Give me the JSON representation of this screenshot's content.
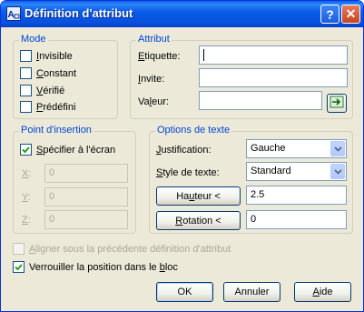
{
  "window": {
    "title": "Définition d'attribut",
    "help_button": "?",
    "close_button": "✕"
  },
  "mode": {
    "legend": "Mode",
    "options": [
      {
        "pre": "",
        "key": "I",
        "post": "nvisible",
        "checked": false
      },
      {
        "pre": "",
        "key": "C",
        "post": "onstant",
        "checked": false
      },
      {
        "pre": "",
        "key": "V",
        "post": "érifié",
        "checked": false
      },
      {
        "pre": "",
        "key": "P",
        "post": "rédéfini",
        "checked": false
      }
    ]
  },
  "attribut": {
    "legend": "Attribut",
    "etiquette": {
      "pre": "",
      "key": "E",
      "post": "tiquette:",
      "value": ""
    },
    "invite": {
      "pre": "",
      "key": "I",
      "post": "nvite:",
      "value": ""
    },
    "valeur": {
      "pre": "Va",
      "key": "l",
      "post": "eur:",
      "value": ""
    }
  },
  "insertion": {
    "legend": "Point d'insertion",
    "specify": {
      "pre": "",
      "key": "S",
      "post": "pécifier à l'écran",
      "checked": true
    },
    "x": {
      "label": "X",
      "suffix": ":",
      "value": "0"
    },
    "y": {
      "label": "Y",
      "suffix": ":",
      "value": "0"
    },
    "z": {
      "label": "Z",
      "suffix": ":",
      "value": "0"
    }
  },
  "texte": {
    "legend": "Options de texte",
    "justification": {
      "pre": "",
      "key": "J",
      "post": "ustification:",
      "value": "Gauche"
    },
    "style": {
      "pre": "",
      "key": "S",
      "post": "tyle de texte:",
      "value": "Standard"
    },
    "hauteur": {
      "pre": "Ha",
      "key": "u",
      "post": "teur <",
      "value": "2.5"
    },
    "rotation": {
      "pre": "",
      "key": "R",
      "post": "otation <",
      "value": "0"
    }
  },
  "align": {
    "pre": "",
    "key": "A",
    "post": "ligner sous la précédente définition d'attribut",
    "checked": false
  },
  "lock": {
    "pre": "Verrouiller la position dans le ",
    "key": "b",
    "post": "loc",
    "checked": true
  },
  "buttons": {
    "ok": "OK",
    "cancel": "Annuler",
    "help_pre": "",
    "help_key": "A",
    "help_post": "ide"
  }
}
